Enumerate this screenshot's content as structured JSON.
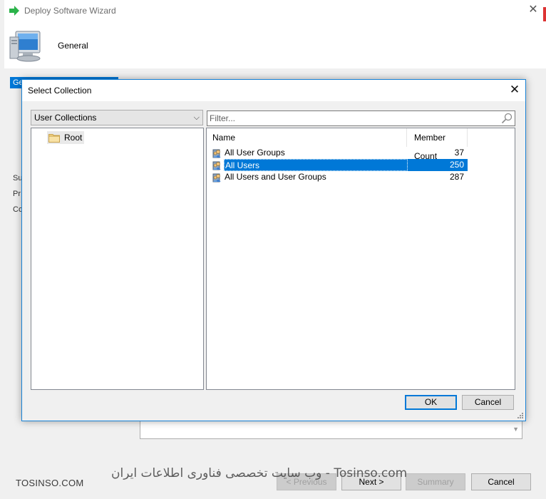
{
  "wizard": {
    "title": "Deploy Software Wizard",
    "header_title": "General",
    "nav_selected": "Ge",
    "nav_items": [
      "Su",
      "Pr",
      "Co"
    ],
    "buttons": {
      "previous": "< Previous",
      "next": "Next >",
      "summary": "Summary",
      "cancel": "Cancel"
    }
  },
  "dialog": {
    "title": "Select Collection",
    "collection_type": "User Collections",
    "tree": {
      "root_label": "Root"
    },
    "filter": {
      "placeholder": "Filter...",
      "value": ""
    },
    "columns": {
      "name": "Name",
      "member_count": "Member Count"
    },
    "rows": [
      {
        "name": "All User Groups",
        "count": "37",
        "selected": false
      },
      {
        "name": "All Users",
        "count": "250",
        "selected": true
      },
      {
        "name": "All Users and User Groups",
        "count": "287",
        "selected": false
      }
    ],
    "ok_label": "OK",
    "cancel_label": "Cancel"
  },
  "watermark": {
    "left": "TOSINSO.COM",
    "center": "وب سایت تخصصی فناوری اطلاعات ایران - Tosinso.com"
  },
  "colors": {
    "accent": "#0078d7",
    "dialog_border": "#1883d7",
    "arrow_green": "#2bb34a"
  }
}
